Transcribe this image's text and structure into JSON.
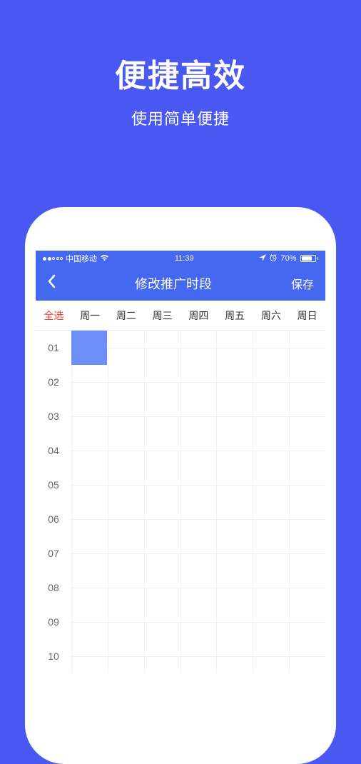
{
  "headline": "便捷高效",
  "subheadline": "使用简单便捷",
  "statusBar": {
    "carrier": "中国移动",
    "time": "11:39",
    "battery": "70%"
  },
  "navBar": {
    "title": "修改推广时段",
    "save": "保存"
  },
  "dayHeaders": {
    "selectAll": "全选",
    "days": [
      "周一",
      "周二",
      "周三",
      "周四",
      "周五",
      "周六",
      "周日"
    ]
  },
  "hours": [
    "01",
    "02",
    "03",
    "04",
    "05",
    "06",
    "07",
    "08",
    "09",
    "10"
  ]
}
